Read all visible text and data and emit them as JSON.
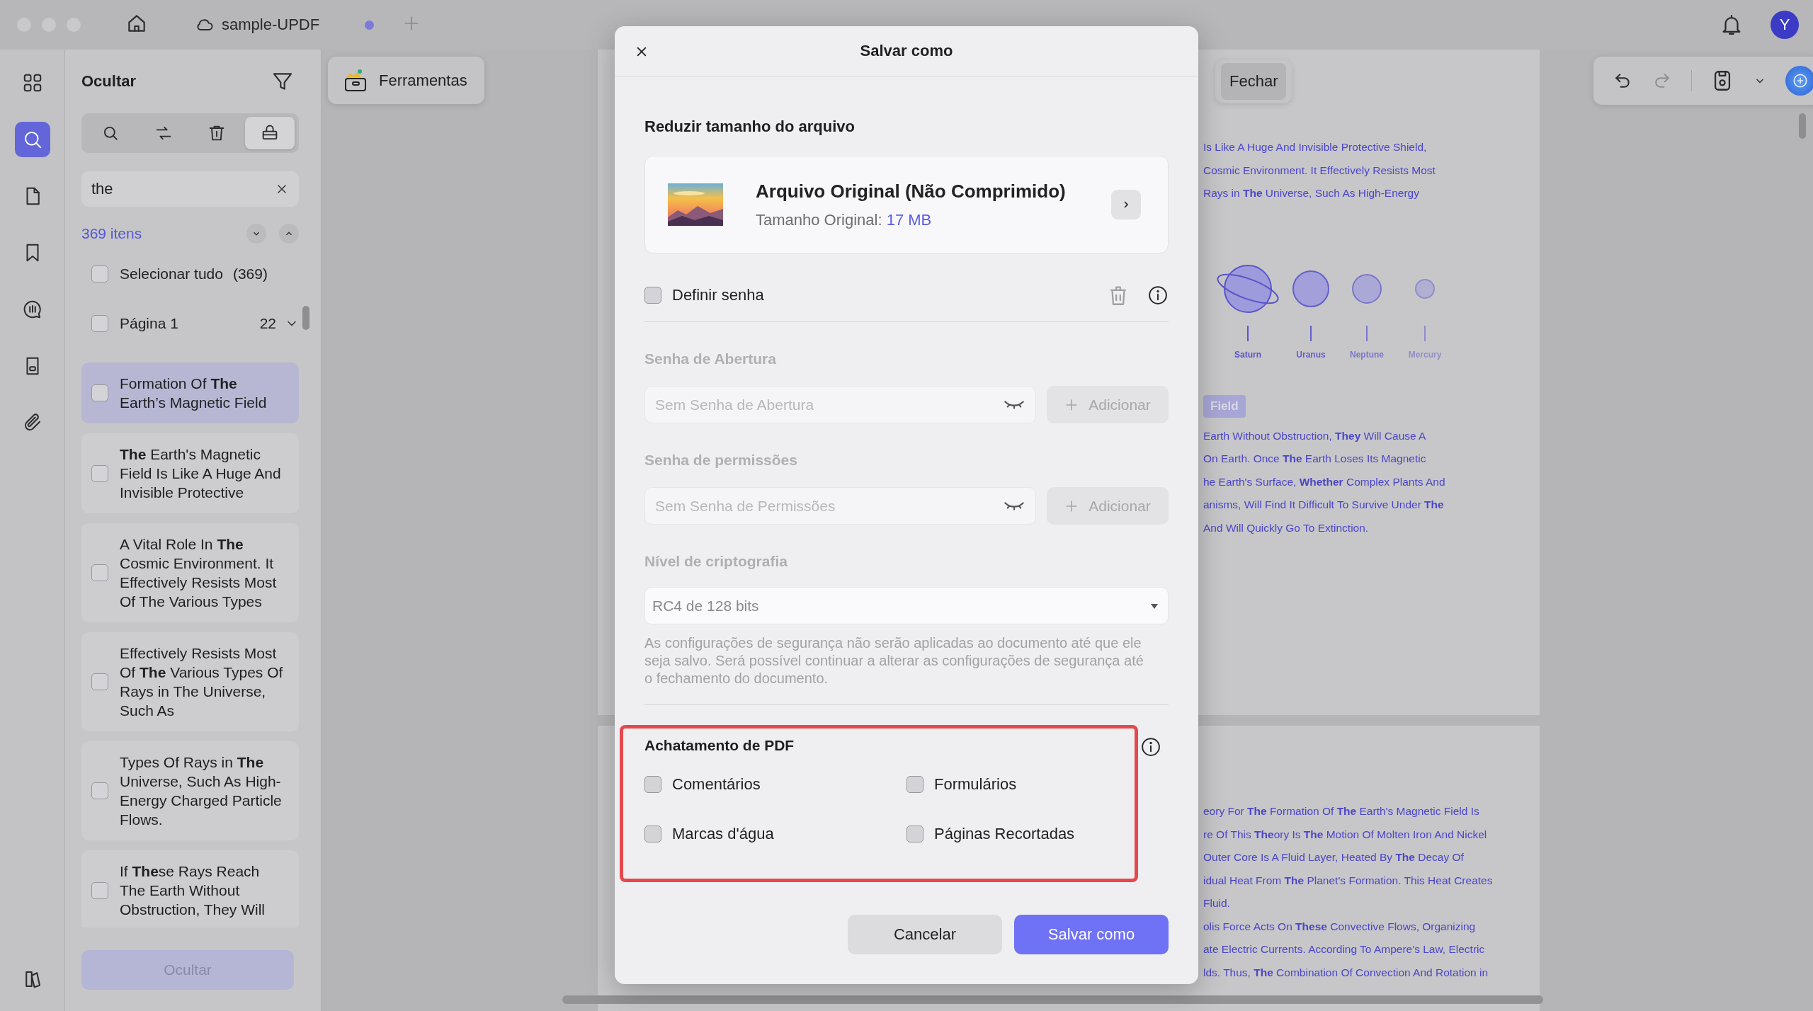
{
  "titlebar": {
    "tab": {
      "title": "sample-UPDF",
      "unsaved": true
    },
    "avatar": "Y"
  },
  "rail": [
    {
      "selected": false
    },
    {
      "selected": true
    },
    {
      "selected": false
    },
    {
      "selected": false
    },
    {
      "selected": false
    },
    {
      "selected": false
    },
    {
      "selected": false
    }
  ],
  "search_panel": {
    "title": "Ocultar",
    "tools": [
      {
        "selected": false
      },
      {
        "selected": false
      },
      {
        "selected": false
      },
      {
        "selected": true
      }
    ],
    "query": "the",
    "count": "369 itens",
    "select_all": {
      "label": "Selecionar tudo",
      "count": "(369)",
      "checked": false
    },
    "page_group": {
      "label": "Página 1",
      "count": "22",
      "checked": false
    },
    "results": [
      {
        "text": "Formation Of **The** Earth’s Magnetic Field",
        "selected": true,
        "checked": false
      },
      {
        "text": "**The** Earth's Magnetic Field Is Like A Huge And Invisible Protective",
        "selected": false,
        "checked": false
      },
      {
        "text": "A Vital Role In **The** Cosmic Environment. It Effectively Resists Most Of The Various Types",
        "selected": false,
        "checked": false
      },
      {
        "text": "Effectively Resists Most Of **The** Various Types Of Rays in The Universe, Such As",
        "selected": false,
        "checked": false
      },
      {
        "text": "Types Of Rays in **The** Universe, Such As High-Energy Charged Particle Flows.",
        "selected": false,
        "checked": false
      },
      {
        "text": "If **The**se Rays Reach The Earth Without Obstruction, They Will",
        "selected": false,
        "checked": false
      }
    ],
    "hide_button": "Ocultar"
  },
  "toolbar": {
    "tools_button": "Ferramentas",
    "close_button": "Fechar"
  },
  "document": {
    "pages": [
      {
        "lines_top": [
          "Is Like A Huge And Invisible Protective Shield,",
          "Cosmic Environment. It Effectively Resists Most",
          "Rays in **The** Universe, Such As High-Energy"
        ],
        "planets": [
          "Saturn",
          "Uranus",
          "Neptune",
          "Mercury"
        ],
        "heading": "Field",
        "lines": [
          "Earth Without Obstruction, **They** Will Cause A",
          "On Earth. Once **The** Earth Loses Its Magnetic",
          "he Earth's Surface, **Whether** Complex Plants And",
          "anisms, Will Find It Difficult To Survive Under **The**",
          "And Will Quickly Go To Extinction."
        ]
      },
      {
        "lines": [
          "eory For **The** Formation Of **The** Earth's Magnetic Field Is",
          "re Of This **The**ory Is **The** Motion Of Molten Iron And Nickel",
          "Outer Core Is A Fluid Layer, Heated By **The** Decay Of",
          "idual Heat From **The** Planet's Formation. This Heat Creates",
          "Fluid.",
          "olis Force Acts On **These** Convective Flows, Organizing",
          "ate Electric Currents. According To Ampere's Law, Electric",
          "lds. Thus, **The** Combination Of Convection And Rotation in"
        ]
      }
    ]
  },
  "dialog": {
    "title": "Salvar como",
    "compress": {
      "heading": "Reduzir tamanho do arquivo",
      "option_title": "Arquivo Original (Não Comprimido)",
      "size_label": "Tamanho Original:",
      "size_value": "17 MB"
    },
    "password": {
      "label": "Definir senha",
      "checked": false
    },
    "password_fields": [
      {
        "label": "Senha de Abertura",
        "placeholder": "Sem Senha de Abertura",
        "button": "Adicionar",
        "disabled": true
      },
      {
        "label": "Senha de permissões",
        "placeholder": "Sem Senha de Permissões",
        "button": "Adicionar",
        "disabled": true
      }
    ],
    "encryption": {
      "label": "Nível de criptografia",
      "value": "RC4 de 128 bits",
      "disabled": true
    },
    "note": "As configurações de segurança não serão aplicadas ao documento até que ele seja salvo. Será possível continuar a alterar as configurações de segurança até o fechamento do documento.",
    "flatten": {
      "heading": "Achatamento de PDF",
      "options": [
        {
          "label": "Comentários",
          "checked": false
        },
        {
          "label": "Formulários",
          "checked": false
        },
        {
          "label": "Marcas d'água",
          "checked": false
        },
        {
          "label": "Páginas Recortadas",
          "checked": false
        }
      ]
    },
    "buttons": [
      {
        "label": "Cancelar",
        "kind": "secondary"
      },
      {
        "label": "Salvar como",
        "kind": "primary"
      }
    ]
  }
}
